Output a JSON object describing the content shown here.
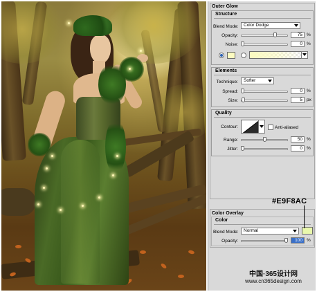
{
  "outer_glow": {
    "title": "Outer Glow",
    "structure": {
      "title": "Structure",
      "blend_mode_label": "Blend Mode:",
      "blend_mode_value": "Color Dodge",
      "opacity_label": "Opacity:",
      "opacity_value": "75",
      "opacity_level": 0.75,
      "noise_label": "Noise:",
      "noise_value": "0",
      "noise_level": 0,
      "percent": "%",
      "glow_color": "#FCFBC0"
    },
    "elements": {
      "title": "Elements",
      "technique_label": "Technique:",
      "technique_value": "Softer",
      "spread_label": "Spread:",
      "spread_value": "0",
      "spread_level": 0,
      "size_label": "Size:",
      "size_value": "5",
      "size_level": 0.02,
      "px": "px",
      "percent": "%"
    },
    "quality": {
      "title": "Quality",
      "contour_label": "Contour:",
      "anti_aliased_label": "Anti-aliased",
      "range_label": "Range:",
      "range_value": "50",
      "range_level": 0.5,
      "jitter_label": "Jitter:",
      "jitter_value": "0",
      "jitter_level": 0,
      "percent": "%"
    }
  },
  "color_overlay": {
    "title": "Color Overlay",
    "color_title": "Color",
    "blend_mode_label": "Blend Mode:",
    "blend_mode_value": "Normal",
    "opacity_label": "Opacity:",
    "opacity_value": "100",
    "opacity_level": 1.0,
    "percent": "%",
    "color": "#E9F8AC"
  },
  "annotation": {
    "hex_label": "#E9F8AC"
  },
  "watermark": {
    "line1": "中国·365设计网",
    "line2": "www.cn365design.com"
  }
}
